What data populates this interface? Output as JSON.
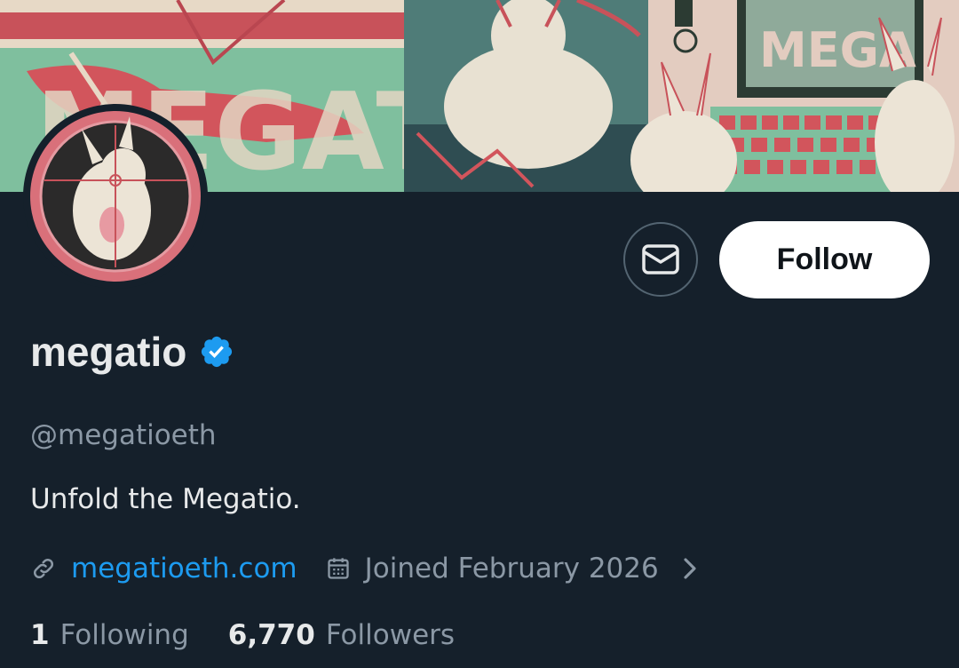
{
  "profile": {
    "display_name": "megatio",
    "handle": "@megatioeth",
    "bio": "Unfold the Megatio.",
    "website": "megatioeth.com",
    "joined": "Joined February 2026",
    "verified": true
  },
  "actions": {
    "follow_label": "Follow"
  },
  "stats": {
    "following_count": "1",
    "following_label": "Following",
    "followers_count": "6,770",
    "followers_label": "Followers"
  },
  "banner": {
    "text_left": "MEGATIO",
    "text_right": "MEGA TIO"
  },
  "colors": {
    "background": "#15202b",
    "text_primary": "#e7e9ea",
    "text_secondary": "#8b98a5",
    "link": "#1d9bf0",
    "verified_badge": "#1d9bf0",
    "follow_button_bg": "#ffffff"
  },
  "icons": {
    "message": "envelope-icon",
    "verified": "verified-badge-icon",
    "link": "link-icon",
    "calendar": "calendar-icon",
    "chevron": "chevron-right-icon"
  }
}
